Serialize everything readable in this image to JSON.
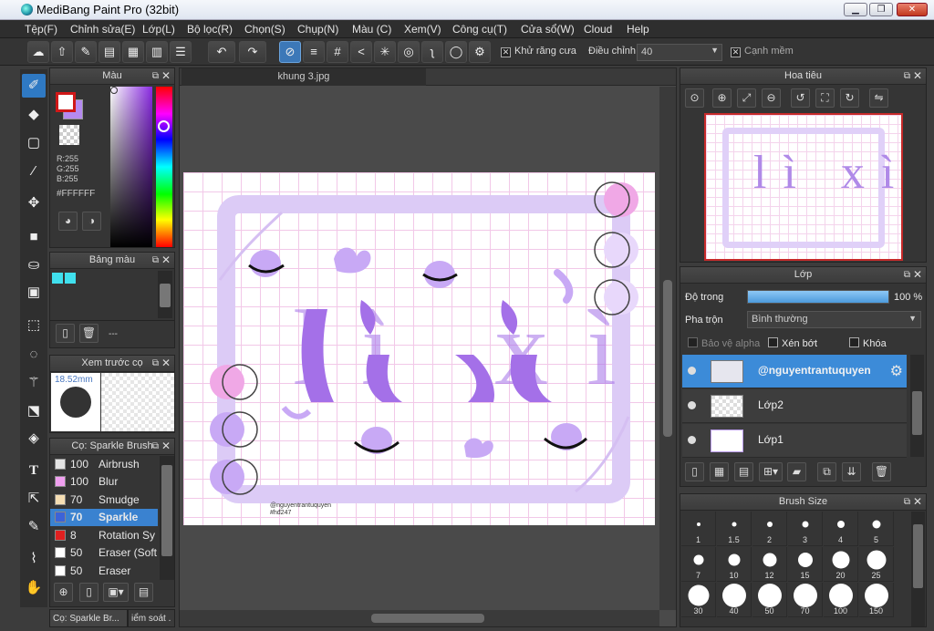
{
  "app": {
    "title": "MediBang Paint Pro (32bit)"
  },
  "menu": [
    "Tệp(F)",
    "Chỉnh sửa(E)",
    "Lớp(L)",
    "Bộ lọc(R)",
    "Chọn(S)",
    "Chụp(N)",
    "Màu (C)",
    "Xem(V)",
    "Công cụ(T)",
    "Cửa sổ(W)",
    "Cloud",
    "Help"
  ],
  "toolbar": {
    "antialias_label": "Khử răng cưa",
    "adjust_label": "Điều chỉnh",
    "adjust_value": "40",
    "soft_edge_label": "Cạnh mềm"
  },
  "color_panel": {
    "title": "Màu",
    "r": "R:255",
    "g": "G:255",
    "b": "B:255",
    "hex": "#FFFFFF",
    "primary": "#ffffff",
    "secondary": "#b58af0"
  },
  "palette_panel": {
    "title": "Bảng màu",
    "swatches": [
      "#40e0ee",
      "#40e0ee"
    ],
    "dash": "---"
  },
  "brush_preview": {
    "title": "Xem trước cọ",
    "size": "18.52mm"
  },
  "brush_panel": {
    "title": "Cọ: Sparkle Brush",
    "items": [
      {
        "size": "100",
        "name": "Airbrush",
        "color": "#e4e4e4"
      },
      {
        "size": "100",
        "name": "Blur",
        "color": "#f0a0f0"
      },
      {
        "size": "70",
        "name": "Smudge",
        "color": "#f5deb3"
      },
      {
        "size": "70",
        "name": "Sparkle",
        "color": "#3c63d8"
      },
      {
        "size": "8",
        "name": "Rotation Sy",
        "color": "#e02020"
      },
      {
        "size": "50",
        "name": "Eraser (Soft",
        "color": "#ffffff"
      },
      {
        "size": "50",
        "name": "Eraser",
        "color": "#ffffff"
      }
    ],
    "bottom_tabs": [
      "Cọ: Sparkle Br...",
      "iểm soát ."
    ]
  },
  "document": {
    "tab": "khung 3.jpg",
    "art_title": "lì xì",
    "credit": "@nguyentrantuquyen",
    "credit2": "#hđ247"
  },
  "navigator": {
    "title": "Hoa tiêu"
  },
  "layer_panel": {
    "title": "Lớp",
    "opacity_label": "Độ trong",
    "opacity_value": "100 %",
    "opacity": 1.0,
    "blend_label": "Pha trộn",
    "blend_value": "Bình thường",
    "protect_alpha": "Bảo vệ alpha",
    "clipping": "Xén bớt",
    "lock": "Khóa",
    "layers": [
      {
        "name": "@nguyentrantuquyen",
        "selected": true
      },
      {
        "name": "Lớp2",
        "selected": false
      },
      {
        "name": "Lớp1",
        "selected": false
      }
    ]
  },
  "brush_size_panel": {
    "title": "Brush Size",
    "sizes": [
      "1",
      "1.5",
      "2",
      "3",
      "4",
      "5",
      "7",
      "10",
      "12",
      "15",
      "20",
      "25",
      "30",
      "40",
      "50",
      "70",
      "100",
      "150"
    ]
  }
}
